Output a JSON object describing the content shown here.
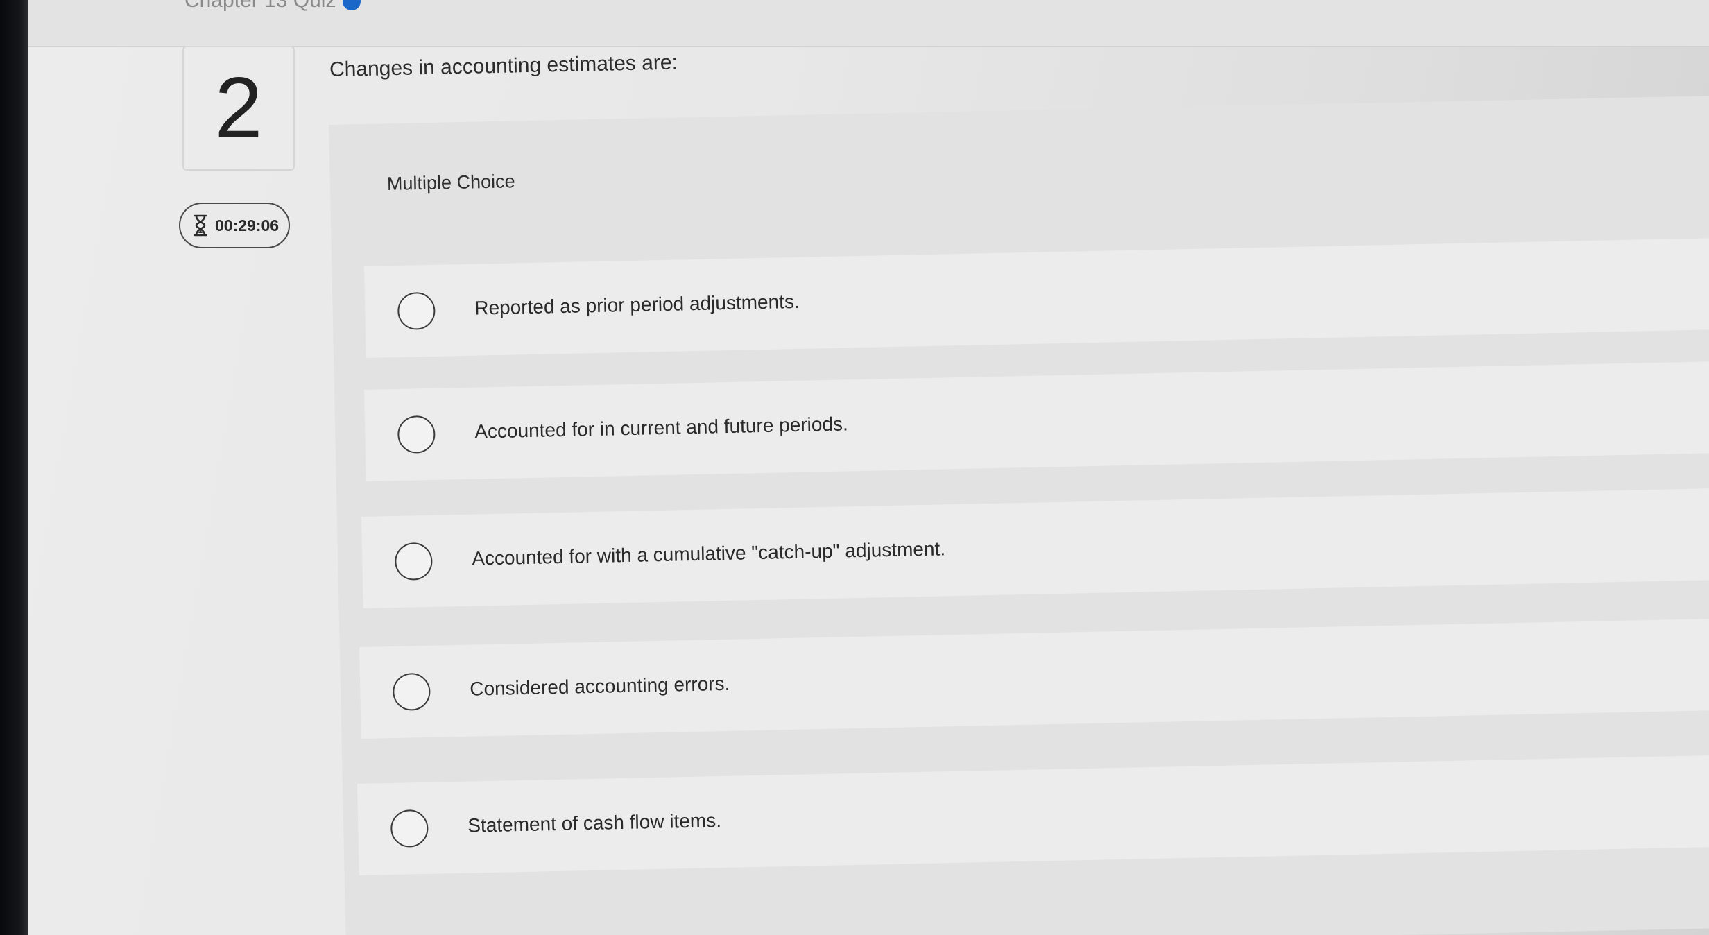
{
  "header": {
    "breadcrumb": "Chapter 13 Quiz"
  },
  "question": {
    "number": "2",
    "timer": "00:29:06",
    "prompt": "Changes in accounting estimates are:",
    "type_label": "Multiple Choice",
    "options": [
      {
        "label": "Reported as prior period adjustments.",
        "selected": false
      },
      {
        "label": "Accounted for in current and future periods.",
        "selected": false
      },
      {
        "label": "Accounted for with a cumulative \"catch-up\" adjustment.",
        "selected": false
      },
      {
        "label": "Considered accounting errors.",
        "selected": false
      },
      {
        "label": "Statement of cash flow items.",
        "selected": false
      }
    ]
  },
  "icons": {
    "timer": "hourglass-icon",
    "option_control": "radio-button"
  }
}
